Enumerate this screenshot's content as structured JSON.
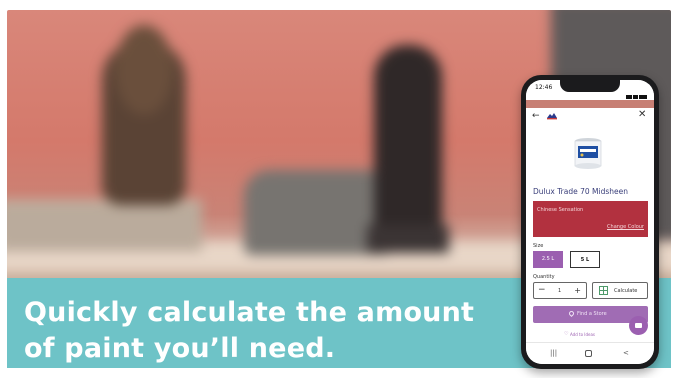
{
  "caption": {
    "line1": "Quickly calculate the amount",
    "line2": "of paint you’ll need."
  },
  "phone": {
    "status_time": "12:46",
    "product_title": "Dulux Trade 70 Midsheen",
    "colour_name": "Chinese Sensation",
    "change_colour_label": "Change Colour",
    "size_label": "Size",
    "size_options": [
      "2.5 L",
      "5 L"
    ],
    "quantity_label": "Quantity",
    "quantity_value": "1",
    "calculate_label": "Calculate",
    "find_store_label": "Find a Store",
    "add_to_ideas_label": "Add to Ideas"
  },
  "colors": {
    "caption_band": "#6ec3c7",
    "selected_colour": "#b2313f",
    "accent_purple": "#9b5fb0",
    "product_title": "#3a3f7a"
  },
  "icons": [
    "back-arrow-icon",
    "brand-logo",
    "close-icon",
    "paint-tin-image",
    "calculator-icon",
    "location-pin-icon",
    "heart-icon",
    "basket-icon",
    "nav-recents-icon",
    "nav-home-icon",
    "nav-back-icon"
  ]
}
